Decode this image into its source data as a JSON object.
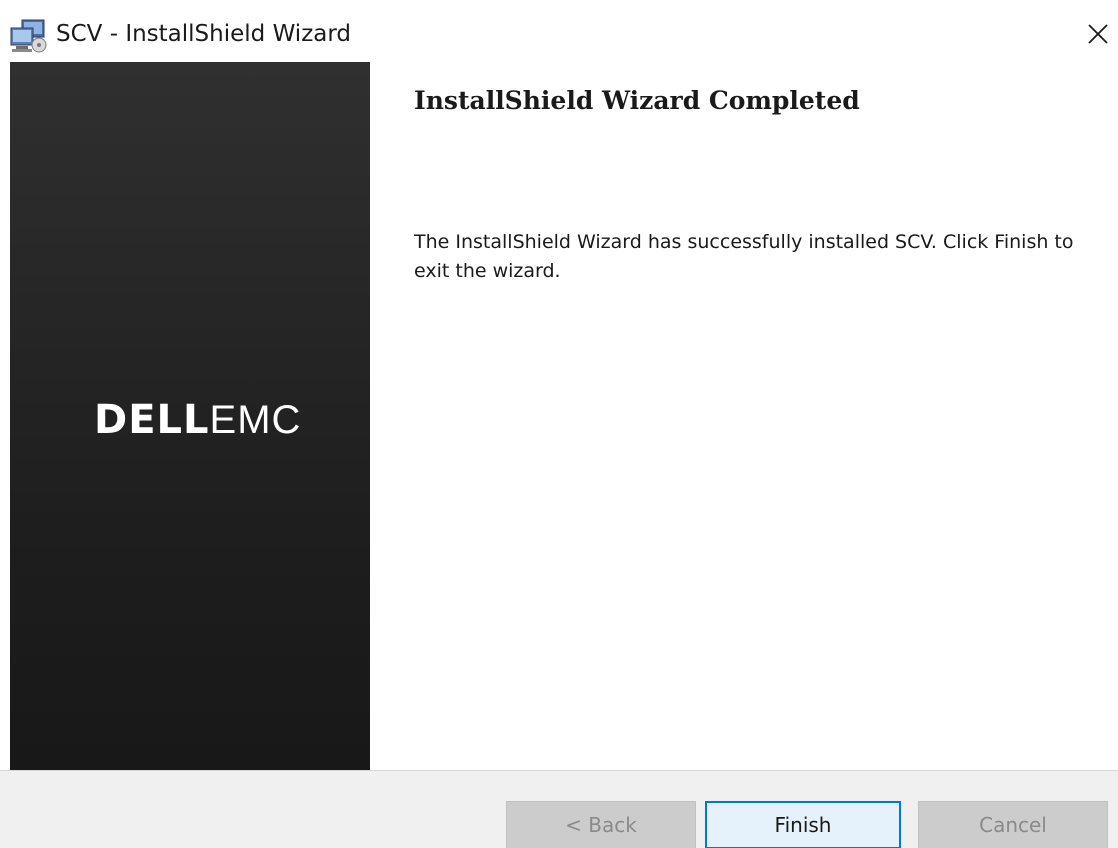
{
  "window": {
    "title": "SCV - InstallShield Wizard",
    "icon": "installer-computer-icon",
    "close_icon": "close-icon"
  },
  "banner": {
    "brand_dell": "DELL",
    "brand_emc": "EMC"
  },
  "content": {
    "heading": "InstallShield Wizard Completed",
    "message": "The InstallShield Wizard has successfully installed SCV. Click Finish to exit the wizard."
  },
  "buttons": {
    "back": {
      "label": "< Back",
      "enabled": false
    },
    "finish": {
      "label": "Finish",
      "enabled": true,
      "default": true
    },
    "cancel": {
      "label": "Cancel",
      "enabled": false
    }
  },
  "colors": {
    "banner_top": "#303030",
    "banner_bottom": "#181818",
    "focus_border": "#0078d7",
    "disabled_button": "#cccccc"
  }
}
